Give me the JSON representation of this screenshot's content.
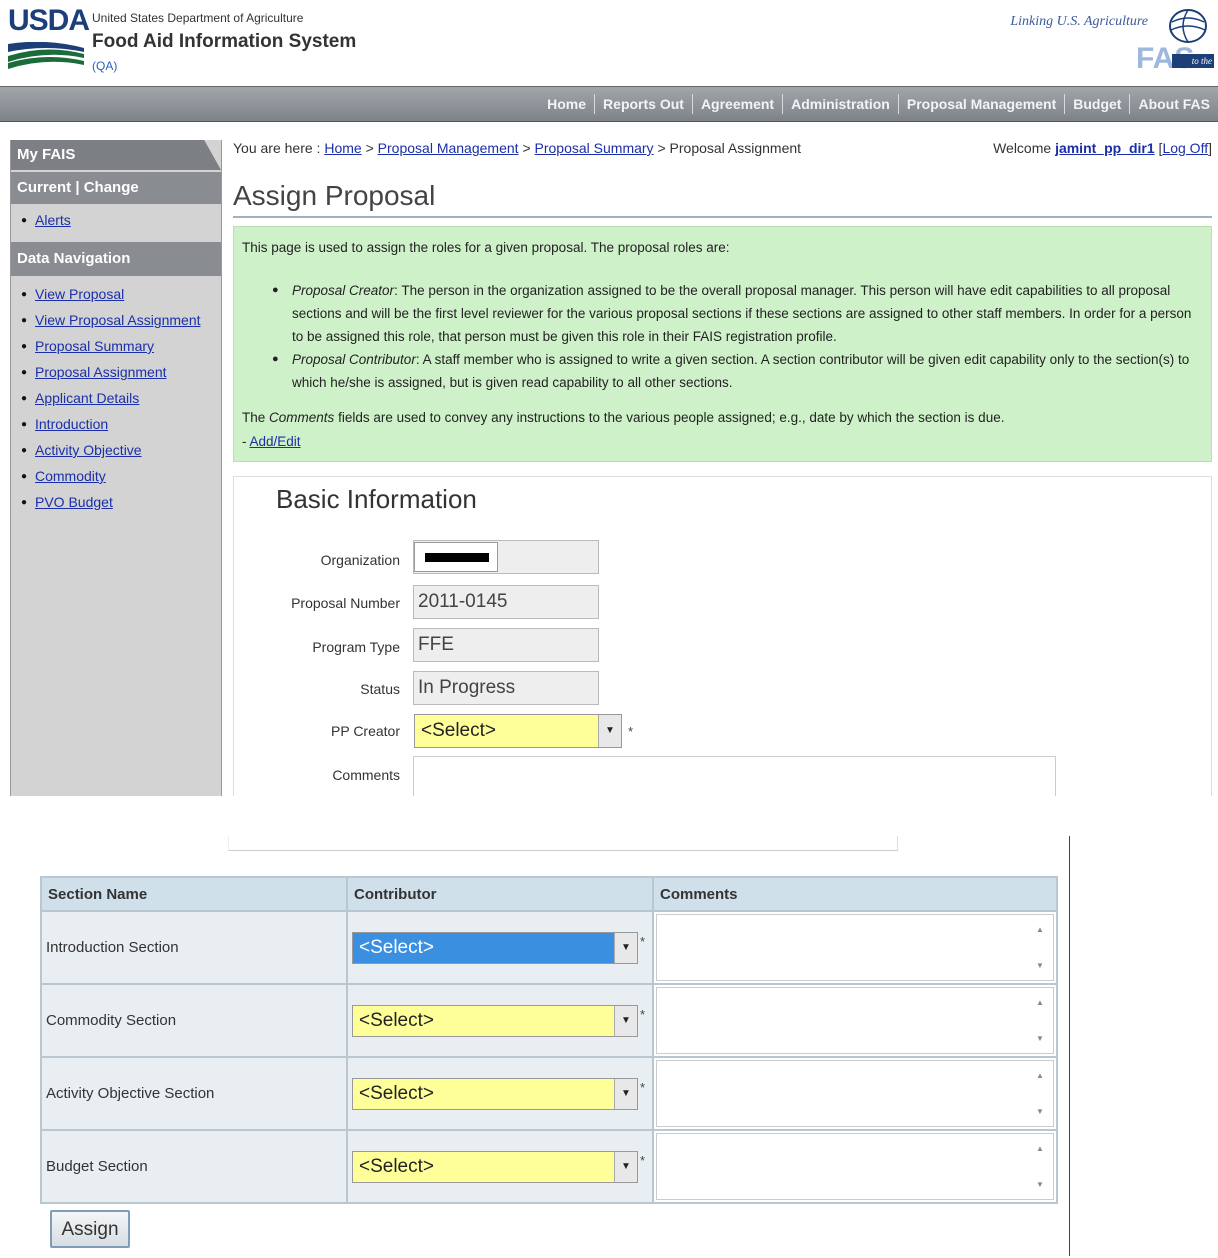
{
  "header": {
    "logo_text": "USDA",
    "department": "United States Department of Agriculture",
    "system_name": "Food Aid Information System",
    "environment": "(QA)",
    "tagline": "Linking U.S. Agriculture",
    "fas_logo_text": "FAS",
    "fas_badge_text": "to the World"
  },
  "nav": {
    "items": [
      "Home",
      "Reports Out",
      "Agreement",
      "Administration",
      "Proposal Management",
      "Budget",
      "About FAS"
    ]
  },
  "sidebar": {
    "my_fais": "My FAIS",
    "current_change": "Current | Change",
    "alerts": "Alerts",
    "data_navigation": "Data Navigation",
    "items": [
      "View Proposal",
      "View Proposal Assignment",
      "Proposal Summary",
      "Proposal Assignment",
      "Applicant Details",
      "Introduction",
      "Activity Objective",
      "Commodity",
      "PVO Budget"
    ]
  },
  "breadcrumb": {
    "prefix": "You are here :",
    "links": [
      "Home",
      "Proposal Management",
      "Proposal Summary"
    ],
    "current": "Proposal Assignment",
    "separator": ">"
  },
  "welcome": {
    "text": "Welcome",
    "user": "jamint_pp_dir1",
    "logoff": "Log Off",
    "open_bracket": "[",
    "close_bracket": "]"
  },
  "page_title": "Assign Proposal",
  "info": {
    "intro": "This page is used to assign the roles for a given proposal. The proposal roles are:",
    "roles": [
      {
        "term": "Proposal Creator",
        "desc": ": The person in the organization assigned to be the overall proposal manager. This person will have edit capabilities to all proposal sections and will be the first level reviewer for the various proposal sections if these sections are assigned to other staff members. In order for a person to be assigned this role, that person must be given this role in their FAIS registration profile."
      },
      {
        "term": "Proposal Contributor",
        "desc": ": A staff member who is assigned to write a given section. A section contributor will be given edit capability only to the section(s) to which he/she is assigned, but is given read capability to all other sections."
      }
    ],
    "comments_prefix": "The",
    "comments_term": "Comments",
    "comments_suffix": "fields are used to convey any instructions to the various people assigned; e.g., date by which the section is due.",
    "addedit_prefix": "-",
    "addedit": "Add/Edit"
  },
  "basic": {
    "legend": "Basic Information",
    "organization_label": "Organization",
    "proposal_number_label": "Proposal Number",
    "proposal_number": "2011-0145",
    "program_type_label": "Program Type",
    "program_type": "FFE",
    "status_label": "Status",
    "status": "In Progress",
    "pp_creator_label": "PP Creator",
    "pp_creator_value": "<Select>",
    "required_mark": "*",
    "comments_label": "Comments"
  },
  "sections_table": {
    "headers": [
      "Section Name",
      "Contributor",
      "Comments"
    ],
    "rows": [
      {
        "name": "Introduction Section",
        "contributor": "<Select>"
      },
      {
        "name": "Commodity Section",
        "contributor": "<Select>"
      },
      {
        "name": "Activity Objective Section",
        "contributor": "<Select>"
      },
      {
        "name": "Budget Section",
        "contributor": "<Select>"
      }
    ],
    "required_mark": "*"
  },
  "assign_button": "Assign",
  "colors": {
    "nav_bar": "#8a8f94",
    "sidebar": "#d3d3d3",
    "info_box": "#cff1c9",
    "select_bg": "#ffff99",
    "select_focus": "#3b8fe0",
    "link": "#1a2fa8",
    "table_header": "#cfe0ea"
  }
}
